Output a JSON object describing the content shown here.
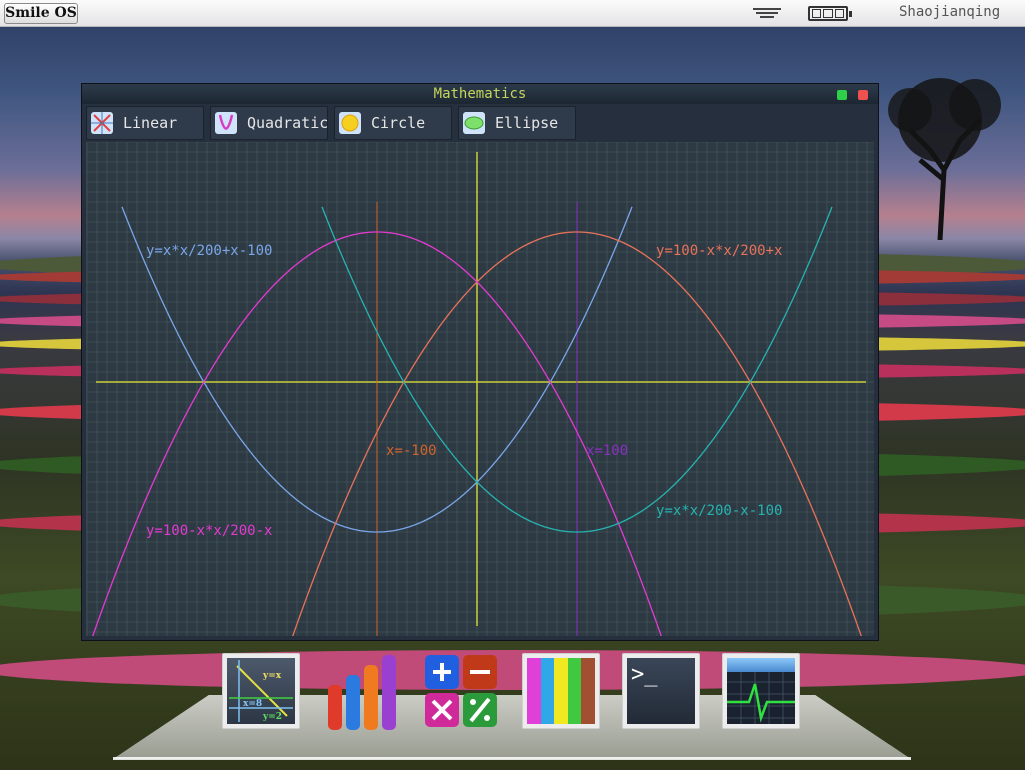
{
  "topbar": {
    "os_button": "Smile OS",
    "menu_icon": "menu-lines-icon",
    "battery_icon": "battery-icon",
    "username": "Shaojianqing"
  },
  "window": {
    "title": "Mathematics",
    "tabs": [
      {
        "label": "Linear",
        "icon": "linear-icon"
      },
      {
        "label": "Quadratic",
        "icon": "quadratic-icon"
      },
      {
        "label": "Circle",
        "icon": "circle-icon"
      },
      {
        "label": "Ellipse",
        "icon": "ellipse-icon"
      }
    ]
  },
  "graph": {
    "labels": {
      "eq1": "y=x*x/200+x-100",
      "eq2": "y=100-x*x/200+x",
      "eq3": "y=100-x*x/200-x",
      "eq4": "y=x*x/200-x-100",
      "vline1": "x=-100",
      "vline2": "x=100"
    },
    "colors": {
      "eq1": "#7aa6ea",
      "eq2": "#e8725a",
      "eq3": "#e43ad0",
      "eq4": "#26b3b0",
      "vline1": "#d2642a",
      "vline2": "#8a30c0",
      "axis": "#c9cf3c",
      "grid": "#4a5a5e",
      "background": "#2d3a44"
    }
  },
  "dock": [
    {
      "name": "math-app",
      "icon": "math-graph-icon",
      "labels": [
        "y=x",
        "x=8",
        "y=2"
      ]
    },
    {
      "name": "chart-app",
      "icon": "bar-chart-icon"
    },
    {
      "name": "calculator-app",
      "icon": "calculator-icon"
    },
    {
      "name": "color-app",
      "icon": "color-palette-icon"
    },
    {
      "name": "terminal-app",
      "icon": "terminal-icon",
      "prompt": ">_"
    },
    {
      "name": "monitor-app",
      "icon": "system-monitor-icon"
    }
  ]
}
